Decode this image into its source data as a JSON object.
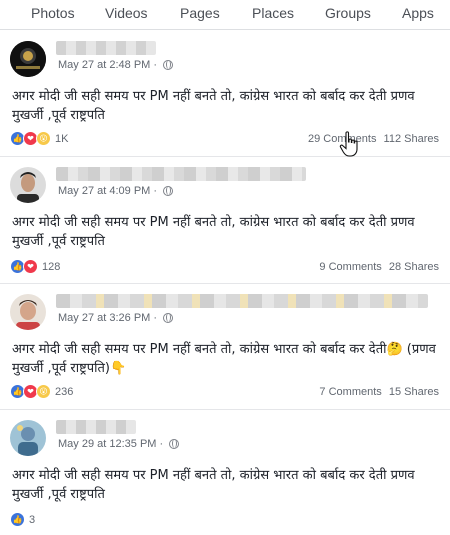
{
  "tabs": [
    "Photos",
    "Videos",
    "Pages",
    "Places",
    "Groups",
    "Apps"
  ],
  "posts": [
    {
      "timestamp": "May 27 at 2:48 PM",
      "text": "अगर मोदी जी सही समय पर PM नहीं बनते तो, कांग्रेस भारत को बर्बाद कर देती प्रणव मुखर्जी ,पूर्व राष्ट्रपति",
      "reactions": [
        "like",
        "love",
        "wow"
      ],
      "reaction_count": "1K",
      "comments": "29 Comments",
      "shares": "112 Shares"
    },
    {
      "timestamp": "May 27 at 4:09 PM",
      "text": "अगर मोदी जी सही समय पर PM नहीं बनते तो, कांग्रेस भारत को बर्बाद कर देती प्रणव मुखर्जी ,पूर्व राष्ट्रपति",
      "reactions": [
        "like",
        "love"
      ],
      "reaction_count": "128",
      "comments": "9 Comments",
      "shares": "28 Shares"
    },
    {
      "timestamp": "May 27 at 3:26 PM",
      "text": "अगर मोदी जी सही समय पर PM नहीं बनते तो, कांग्रेस भारत को बर्बाद कर देती🤔 (प्रणव मुखर्जी ,पूर्व राष्ट्रपति)👇",
      "reactions": [
        "like",
        "love",
        "wow"
      ],
      "reaction_count": "236",
      "comments": "7 Comments",
      "shares": "15 Shares"
    },
    {
      "timestamp": "May 29 at 12:35 PM",
      "text": "अगर मोदी जी सही समय पर PM नहीं बनते तो, कांग्रेस भारत को बर्बाद कर देती प्रणव मुखर्जी ,पूर्व राष्ट्रपति",
      "reactions": [
        "like"
      ],
      "reaction_count": "3",
      "comments": "",
      "shares": ""
    }
  ],
  "icons": {
    "like": "thumbs-up-icon",
    "love": "heart-icon",
    "wow": "wow-face-icon",
    "privacy": "globe-icon",
    "cursor": "hand-pointer-icon"
  },
  "colors": {
    "like": "#3b73db",
    "love": "#f0394c",
    "wow": "#f7c94a",
    "meta_text": "#616770",
    "divider": "#e5e6e9"
  }
}
